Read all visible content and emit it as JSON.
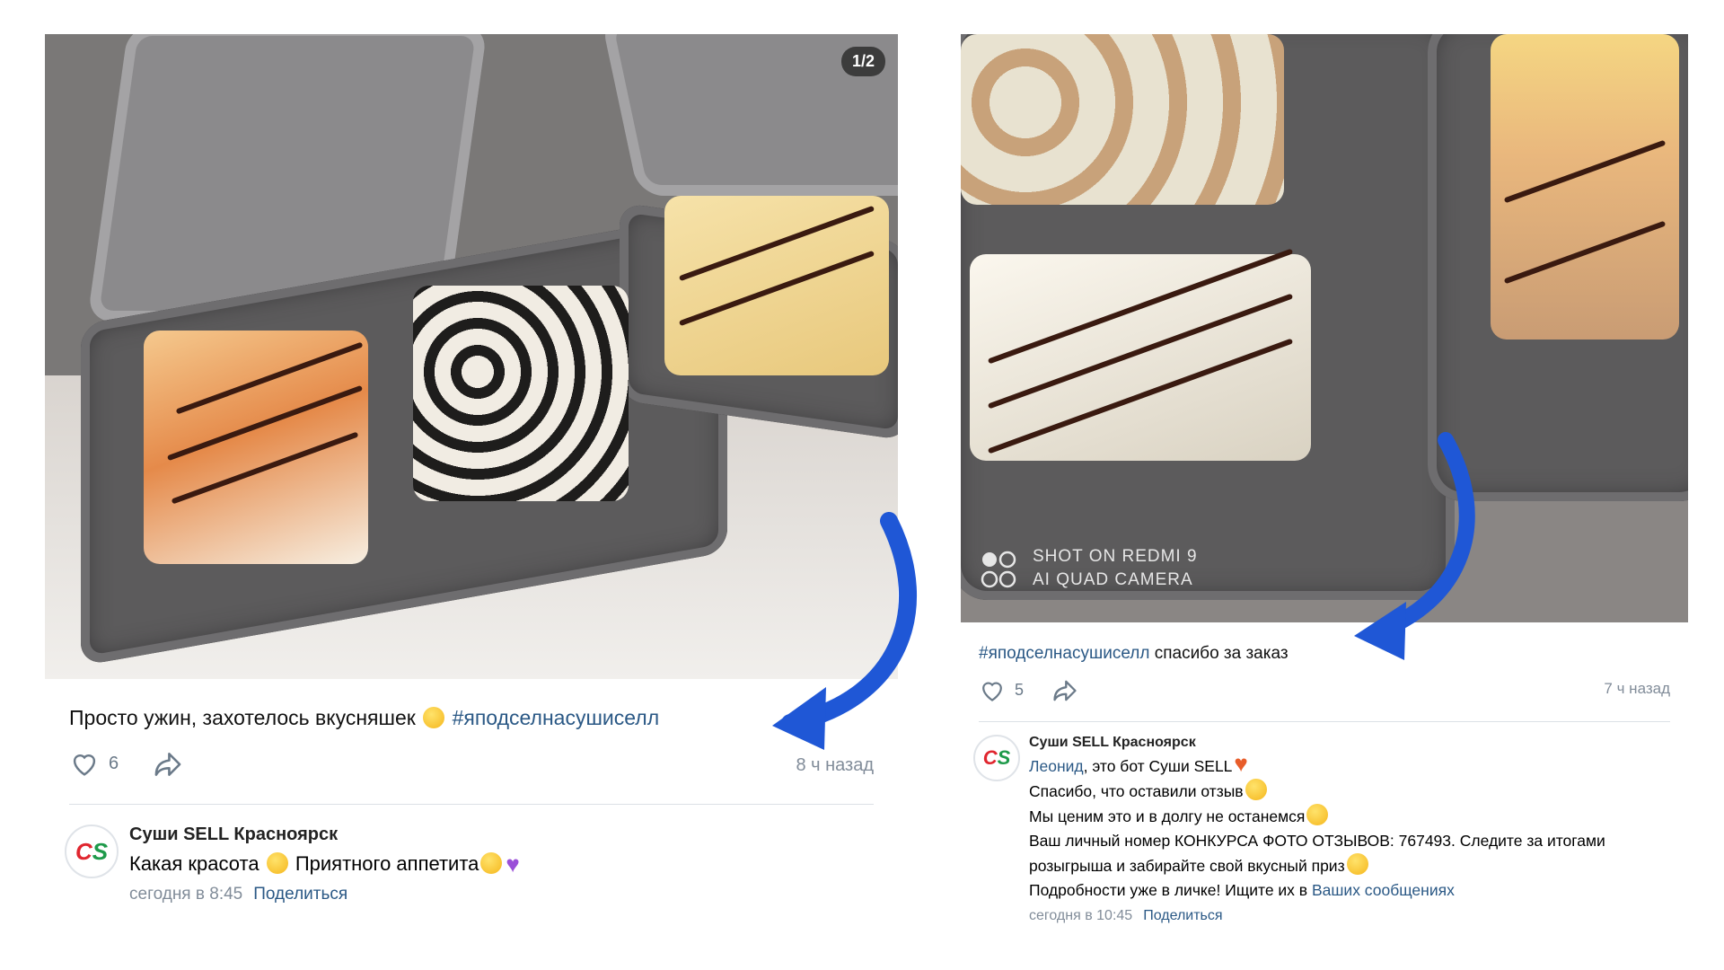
{
  "left_post": {
    "photo_counter": "1/2",
    "caption_text": "Просто ужин, захотелось вкусняшек ",
    "caption_hashtag": "#яподселнасушиселл",
    "likes": "6",
    "time_ago": "8 ч назад",
    "comment": {
      "avatar_letters": [
        "C",
        "S"
      ],
      "author": "Суши SELL Красноярск",
      "text_a": "Какая красота ",
      "text_b": " Приятного аппетита",
      "timestamp": "сегодня в 8:45",
      "share_label": "Поделиться"
    }
  },
  "right_post": {
    "watermark_line1": "SHOT ON REDMI 9",
    "watermark_line2": "AI QUAD CAMERA",
    "caption_hashtag": "#яподселнасушиселл",
    "caption_text": " спасибо за заказ",
    "likes": "5",
    "time_ago": "7 ч назад",
    "comment": {
      "avatar_letters": [
        "C",
        "S"
      ],
      "author": "Суши SELL Красноярск",
      "mention": "Леонид",
      "line1_rest": ", это бот Суши SELL",
      "line2": "Спасибо, что оставили отзыв",
      "line3": "Мы ценим это и в долгу не останемся",
      "line4": "Ваш личный номер КОНКУРСА ФОТО ОТЗЫВОВ: 767493. Следите за итогами",
      "line5": "розыгрыша и забирайте свой вкусный приз",
      "line6_text": "Подробности уже в личке! Ищите их в ",
      "line6_link": "Ваших сообщениях",
      "timestamp": "сегодня в 10:45",
      "share_label": "Поделиться"
    }
  },
  "colors": {
    "link": "#2a5885",
    "meta": "#818c99",
    "arrow": "#1f57d6",
    "logo_red": "#e0262f",
    "logo_green": "#1e9a4a"
  },
  "icons": [
    "heart-outline-icon",
    "share-arrow-icon",
    "curved-arrow-icon",
    "camera-rings-icon"
  ]
}
